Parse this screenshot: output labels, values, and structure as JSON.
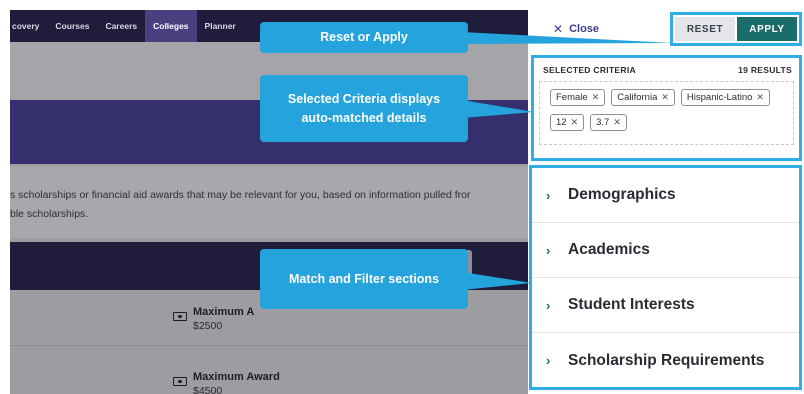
{
  "nav": {
    "items": [
      "covery",
      "Courses",
      "Careers",
      "Colleges",
      "Planner"
    ],
    "active_index": 3
  },
  "intro": {
    "line1": "s scholarships or financial aid awards that may be relevant for you, based on information pulled fror",
    "line2": "ble scholarships."
  },
  "awards": [
    {
      "label": "Maximum A",
      "value": "$2500"
    },
    {
      "label": "Maximum Award",
      "value": "$4500"
    }
  ],
  "panel": {
    "close_label": "Close",
    "reset_label": "RESET",
    "apply_label": "APPLY",
    "criteria": {
      "heading": "SELECTED CRITERIA",
      "results": "19 RESULTS",
      "chips": [
        "Female",
        "California",
        "Hispanic-Latino",
        "12",
        "3.7"
      ]
    },
    "sections": [
      "Demographics",
      "Academics",
      "Student Interests",
      "Scholarship Requirements"
    ]
  },
  "callouts": {
    "reset_apply": "Reset or Apply",
    "criteria_line1": "Selected Criteria displays",
    "criteria_line2": "auto-matched details",
    "match_filter": "Match and Filter sections"
  },
  "colors": {
    "callout": "#24a3dc",
    "highlight_border": "#2eaee4",
    "apply_button": "#1b6d6b",
    "nav_background": "#1f1c3c",
    "nav_active": "#4a4080"
  },
  "icons": {
    "close": "close-icon",
    "chevron": "chevron-right-icon",
    "money": "money-icon",
    "chip_remove": "remove-x-icon"
  }
}
